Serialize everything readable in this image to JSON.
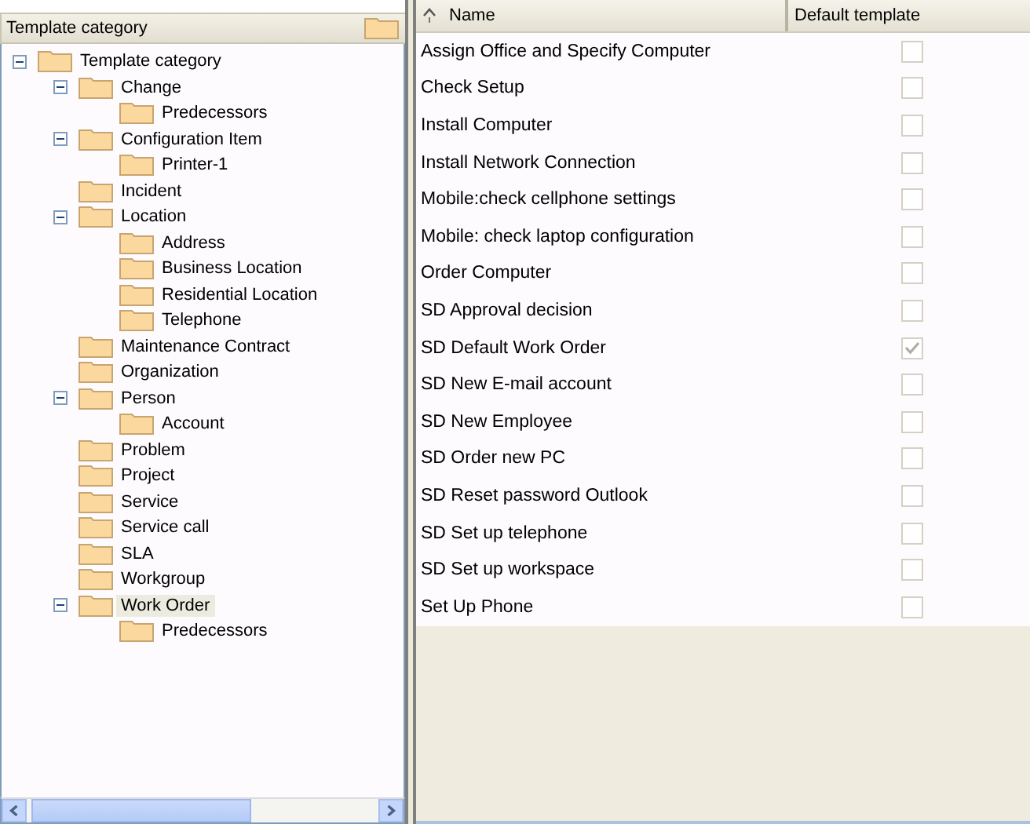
{
  "tree_panel": {
    "header": "Template category",
    "nodes": [
      {
        "label": "Template category",
        "expanded": true,
        "selected": false,
        "children": [
          {
            "label": "Change",
            "expanded": true,
            "selected": false,
            "children": [
              {
                "label": "Predecessors",
                "selected": false
              }
            ]
          },
          {
            "label": "Configuration Item",
            "expanded": true,
            "selected": false,
            "children": [
              {
                "label": "Printer-1",
                "selected": false
              }
            ]
          },
          {
            "label": "Incident",
            "selected": false
          },
          {
            "label": "Location",
            "expanded": true,
            "selected": false,
            "children": [
              {
                "label": "Address",
                "selected": false
              },
              {
                "label": "Business Location",
                "selected": false
              },
              {
                "label": "Residential Location",
                "selected": false
              },
              {
                "label": "Telephone",
                "selected": false
              }
            ]
          },
          {
            "label": "Maintenance Contract",
            "selected": false
          },
          {
            "label": "Organization",
            "selected": false
          },
          {
            "label": "Person",
            "expanded": true,
            "selected": false,
            "children": [
              {
                "label": "Account",
                "selected": false
              }
            ]
          },
          {
            "label": "Problem",
            "selected": false
          },
          {
            "label": "Project",
            "selected": false
          },
          {
            "label": "Service",
            "selected": false
          },
          {
            "label": "Service call",
            "selected": false
          },
          {
            "label": "SLA",
            "selected": false
          },
          {
            "label": "Workgroup",
            "selected": false
          },
          {
            "label": "Work Order",
            "expanded": true,
            "selected": true,
            "children": [
              {
                "label": "Predecessors",
                "selected": false
              }
            ]
          }
        ]
      }
    ]
  },
  "table": {
    "columns": [
      "Name",
      "Default template"
    ],
    "rows": [
      {
        "name": "Assign Office and Specify Computer",
        "default": false
      },
      {
        "name": "Check Setup",
        "default": false
      },
      {
        "name": "Install Computer",
        "default": false
      },
      {
        "name": "Install Network Connection",
        "default": false
      },
      {
        "name": "Mobile:check cellphone settings",
        "default": false
      },
      {
        "name": "Mobile: check laptop configuration",
        "default": false
      },
      {
        "name": "Order Computer",
        "default": false
      },
      {
        "name": "SD Approval decision",
        "default": false
      },
      {
        "name": "SD Default Work Order",
        "default": true
      },
      {
        "name": "SD New E-mail  account",
        "default": false
      },
      {
        "name": "SD New Employee",
        "default": false
      },
      {
        "name": "SD Order new PC",
        "default": false
      },
      {
        "name": "SD Reset password Outlook",
        "default": false
      },
      {
        "name": "SD Set up telephone",
        "default": false
      },
      {
        "name": "SD Set up workspace",
        "default": false
      },
      {
        "name": "Set Up Phone",
        "default": false
      }
    ]
  }
}
